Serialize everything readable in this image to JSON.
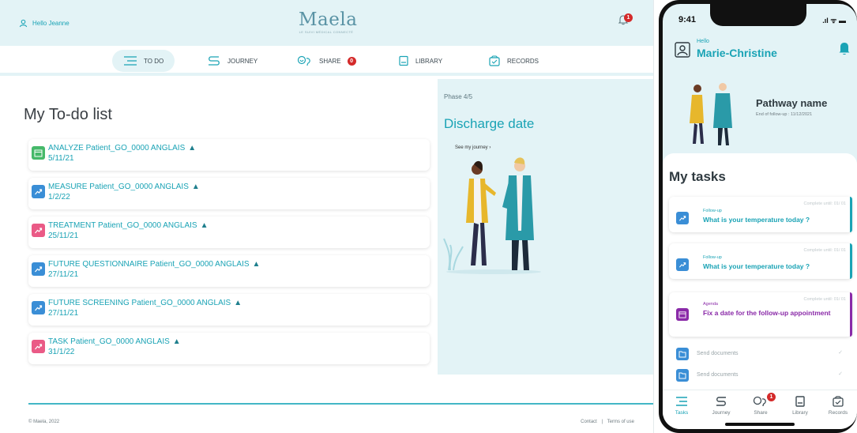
{
  "web": {
    "header": {
      "hello": "Hello Jeanne",
      "logo": "Maela",
      "tagline": "LE SUIVI MÉDICAL CONNECTÉ",
      "notif_count": "1"
    },
    "nav": [
      {
        "label": "TO DO",
        "icon": "list-icon"
      },
      {
        "label": "JOURNEY",
        "icon": "journey-icon"
      },
      {
        "label": "SHARE",
        "icon": "share-icon",
        "badge": "0"
      },
      {
        "label": "LIBRARY",
        "icon": "library-icon"
      },
      {
        "label": "RECORDS",
        "icon": "records-icon"
      }
    ],
    "title": "My To-do list",
    "tasks": [
      {
        "title": "ANALYZE Patient_GO_0000 ANGLAIS",
        "date": "5/11/21",
        "icon": "calendar-icon",
        "color": "#46b96a"
      },
      {
        "title": "MEASURE Patient_GO_0000 ANGLAIS",
        "date": "1/2/22",
        "icon": "trend-icon",
        "color": "#3a8ed6"
      },
      {
        "title": "TREATMENT Patient_GO_0000 ANGLAIS",
        "date": "25/11/21",
        "icon": "trend-icon",
        "color": "#ea5a86"
      },
      {
        "title": "FUTURE QUESTIONNAIRE Patient_GO_0000 ANGLAIS",
        "date": "27/11/21",
        "icon": "trend-icon",
        "color": "#3a8ed6"
      },
      {
        "title": "FUTURE SCREENING Patient_GO_0000 ANGLAIS",
        "date": "27/11/21",
        "icon": "trend-icon",
        "color": "#3a8ed6"
      },
      {
        "title": "TASK Patient_GO_0000 ANGLAIS",
        "date": "31/1/22",
        "icon": "trend-icon",
        "color": "#ea5a86"
      }
    ],
    "warning_glyph": "▲",
    "phase": {
      "label": "Phase 4/5",
      "title": "Discharge date",
      "link": "See my journey ›"
    },
    "footer": {
      "copyright": "© Maela, 2022",
      "contact": "Contact",
      "separator": "|",
      "terms": "Terms of use"
    }
  },
  "mobile": {
    "status": {
      "time": "9:41",
      "right": ".ıl ᯤ ▬"
    },
    "hello": "Hello",
    "name": "Marie-Christine",
    "pathway": {
      "name": "Pathway name",
      "end": "End of follow-up : 11/12/2021"
    },
    "tasks_title": "My tasks",
    "cards": [
      {
        "category": "Follow-up",
        "until": "Complete until: 01/ 01",
        "title": "What is your temperature today ?",
        "color": "#1aa3b5",
        "icon_color": "#3a8ed6",
        "icon": "trend-icon"
      },
      {
        "category": "Follow-up",
        "until": "Complete until: 01/ 01",
        "title": "What is your temperature today ?",
        "color": "#1aa3b5",
        "icon_color": "#3a8ed6",
        "icon": "trend-icon"
      },
      {
        "category": "Agenda",
        "until": "Complete until: 01/ 01",
        "title": "Fix a date for the follow-up appointment",
        "color": "#8a2aa8",
        "icon_color": "#8a2aa8",
        "icon": "calendar-icon"
      }
    ],
    "done": [
      {
        "label": "Send documents",
        "check": "✓"
      },
      {
        "label": "Send documents",
        "check": "✓"
      }
    ],
    "tabs": [
      {
        "label": "Tasks",
        "icon": "list-icon"
      },
      {
        "label": "Journey",
        "icon": "journey-icon"
      },
      {
        "label": "Share",
        "icon": "share-icon",
        "badge": "1"
      },
      {
        "label": "Library",
        "icon": "library-icon"
      },
      {
        "label": "Records",
        "icon": "records-icon"
      }
    ]
  },
  "colors": {
    "primary": "#1aa3b5",
    "light": "#e3f3f6",
    "badge": "#d42a2a"
  }
}
